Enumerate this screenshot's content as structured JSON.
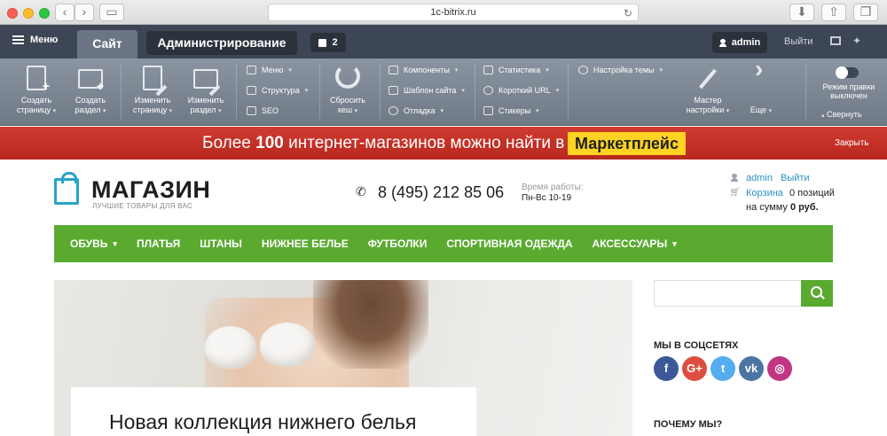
{
  "browser": {
    "url": "1c-bitrix.ru"
  },
  "admin_top": {
    "menu_label": "Меню",
    "tab_site": "Сайт",
    "tab_admin": "Администрирование",
    "notifications_count": "2",
    "username": "admin",
    "logout": "Выйти"
  },
  "toolbar": {
    "create_page": [
      "Создать",
      "страницу"
    ],
    "create_section": [
      "Создать",
      "раздел"
    ],
    "edit_page": [
      "Изменить",
      "страницу"
    ],
    "edit_section": [
      "Изменить",
      "раздел"
    ],
    "menu": "Меню",
    "structure": "Структура",
    "seo": "SEO",
    "reset_cache": [
      "Сбросить",
      "кеш"
    ],
    "components": "Компоненты",
    "site_template": "Шаблон сайта",
    "debug": "Отладка",
    "statistics": "Статистика",
    "short_url": "Короткий URL",
    "stickers": "Стикеры",
    "theme_settings": "Настройка темы",
    "wizard": [
      "Мастер",
      "настройки"
    ],
    "more": "Еще",
    "edit_mode": [
      "Режим правки",
      "выключен"
    ],
    "collapse": "Свернуть"
  },
  "promo": {
    "text_prefix": "Более ",
    "text_number": "100",
    "text_suffix": " интернет-магазинов можно найти в",
    "button": "Маркетплейс",
    "close": "Закрыть"
  },
  "header": {
    "logo_name": "МАГАЗИН",
    "logo_tagline": "ЛУЧШИЕ ТОВАРЫ ДЛЯ ВАС",
    "phone": "8 (495) 212 85 06",
    "hours_label": "Время работы:",
    "hours": "Пн-Вс 10-19",
    "user": "admin",
    "logout": "Выйти",
    "cart_label": "Корзина",
    "cart_count": "0 позиций",
    "cart_sum_prefix": "на сумму ",
    "cart_sum": "0 руб."
  },
  "nav": [
    {
      "label": "ОБУВЬ",
      "has_dropdown": true
    },
    {
      "label": "ПЛАТЬЯ",
      "has_dropdown": false
    },
    {
      "label": "ШТАНЫ",
      "has_dropdown": false
    },
    {
      "label": "НИЖНЕЕ БЕЛЬЕ",
      "has_dropdown": false
    },
    {
      "label": "ФУТБОЛКИ",
      "has_dropdown": false
    },
    {
      "label": "СПОРТИВНАЯ ОДЕЖДА",
      "has_dropdown": false
    },
    {
      "label": "АКСЕССУАРЫ",
      "has_dropdown": true
    }
  ],
  "hero": {
    "title": "Новая коллекция нижнего белья"
  },
  "sidebar": {
    "search_placeholder": "",
    "social_title": "МЫ В СОЦСЕТЯХ",
    "social": [
      {
        "name": "facebook-icon",
        "glyph": "f",
        "color": "#3b5998"
      },
      {
        "name": "google-plus-icon",
        "glyph": "G+",
        "color": "#dc4e41"
      },
      {
        "name": "twitter-icon",
        "glyph": "t",
        "color": "#55acee"
      },
      {
        "name": "vk-icon",
        "glyph": "vk",
        "color": "#4c75a3"
      },
      {
        "name": "instagram-icon",
        "glyph": "◎",
        "color": "#c13584"
      }
    ],
    "why_title": "ПОЧЕМУ МЫ?"
  },
  "colors": {
    "admin_dark": "#3d4654",
    "nav_green": "#5aaa30",
    "promo_red": "#c3302a",
    "promo_yellow": "#ffd324",
    "link_blue": "#2a8fc0"
  }
}
